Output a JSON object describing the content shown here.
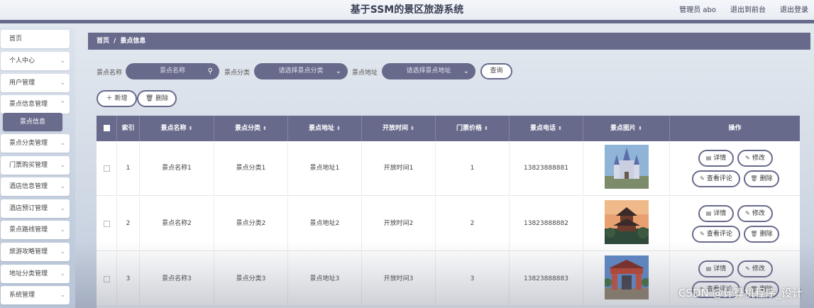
{
  "header": {
    "title": "基于SSM的景区旅游系统",
    "user": "管理员 abo",
    "to_front": "退出到前台",
    "logout": "退出登录"
  },
  "sidebar": {
    "items": [
      {
        "label": "首页",
        "chevron": false
      },
      {
        "label": "个人中心",
        "chevron": true
      },
      {
        "label": "用户管理",
        "chevron": true
      },
      {
        "label": "景点信息管理",
        "chevron": true
      },
      {
        "label": "景点信息",
        "chevron": false,
        "sub": true,
        "active": true
      },
      {
        "label": "景点分类管理",
        "chevron": true
      },
      {
        "label": "门票购买管理",
        "chevron": true
      },
      {
        "label": "酒店信息管理",
        "chevron": true
      },
      {
        "label": "酒店预订管理",
        "chevron": true
      },
      {
        "label": "景点路线管理",
        "chevron": true
      },
      {
        "label": "旅游攻略管理",
        "chevron": true
      },
      {
        "label": "地址分类管理",
        "chevron": true
      },
      {
        "label": "系统管理",
        "chevron": true
      }
    ]
  },
  "breadcrumb": {
    "home": "首页",
    "sep": "/",
    "current": "景点信息"
  },
  "filters": {
    "name_label": "景点名称",
    "name_placeholder": "景点名称",
    "category_label": "景点分类",
    "category_placeholder": "请选择景点分类",
    "address_label": "景点地址",
    "address_placeholder": "请选择景点地址",
    "query_label": "查询"
  },
  "toolbar": {
    "add_label": "新增",
    "delete_label": "删除"
  },
  "table": {
    "columns": [
      "索引",
      "景点名称",
      "景点分类",
      "景点地址",
      "开放时间",
      "门票价格",
      "景点电话",
      "景点图片",
      "操作"
    ],
    "rows": [
      {
        "index": "1",
        "name": "景点名称1",
        "category": "景点分类1",
        "address": "景点地址1",
        "open_time": "开放时间1",
        "price": "1",
        "phone": "13823888881"
      },
      {
        "index": "2",
        "name": "景点名称2",
        "category": "景点分类2",
        "address": "景点地址2",
        "open_time": "开放时间2",
        "price": "2",
        "phone": "13823888882"
      },
      {
        "index": "3",
        "name": "景点名称3",
        "category": "景点分类3",
        "address": "景点地址3",
        "open_time": "开放时间3",
        "price": "3",
        "phone": "13823888883"
      }
    ],
    "actions": {
      "detail": "详情",
      "edit": "修改",
      "comments": "查看评论",
      "delete": "删除"
    }
  },
  "watermark": "CSDN @计算机程序_设计",
  "colors": {
    "primary": "#686a8c",
    "header_bg": "#eef1f6"
  }
}
